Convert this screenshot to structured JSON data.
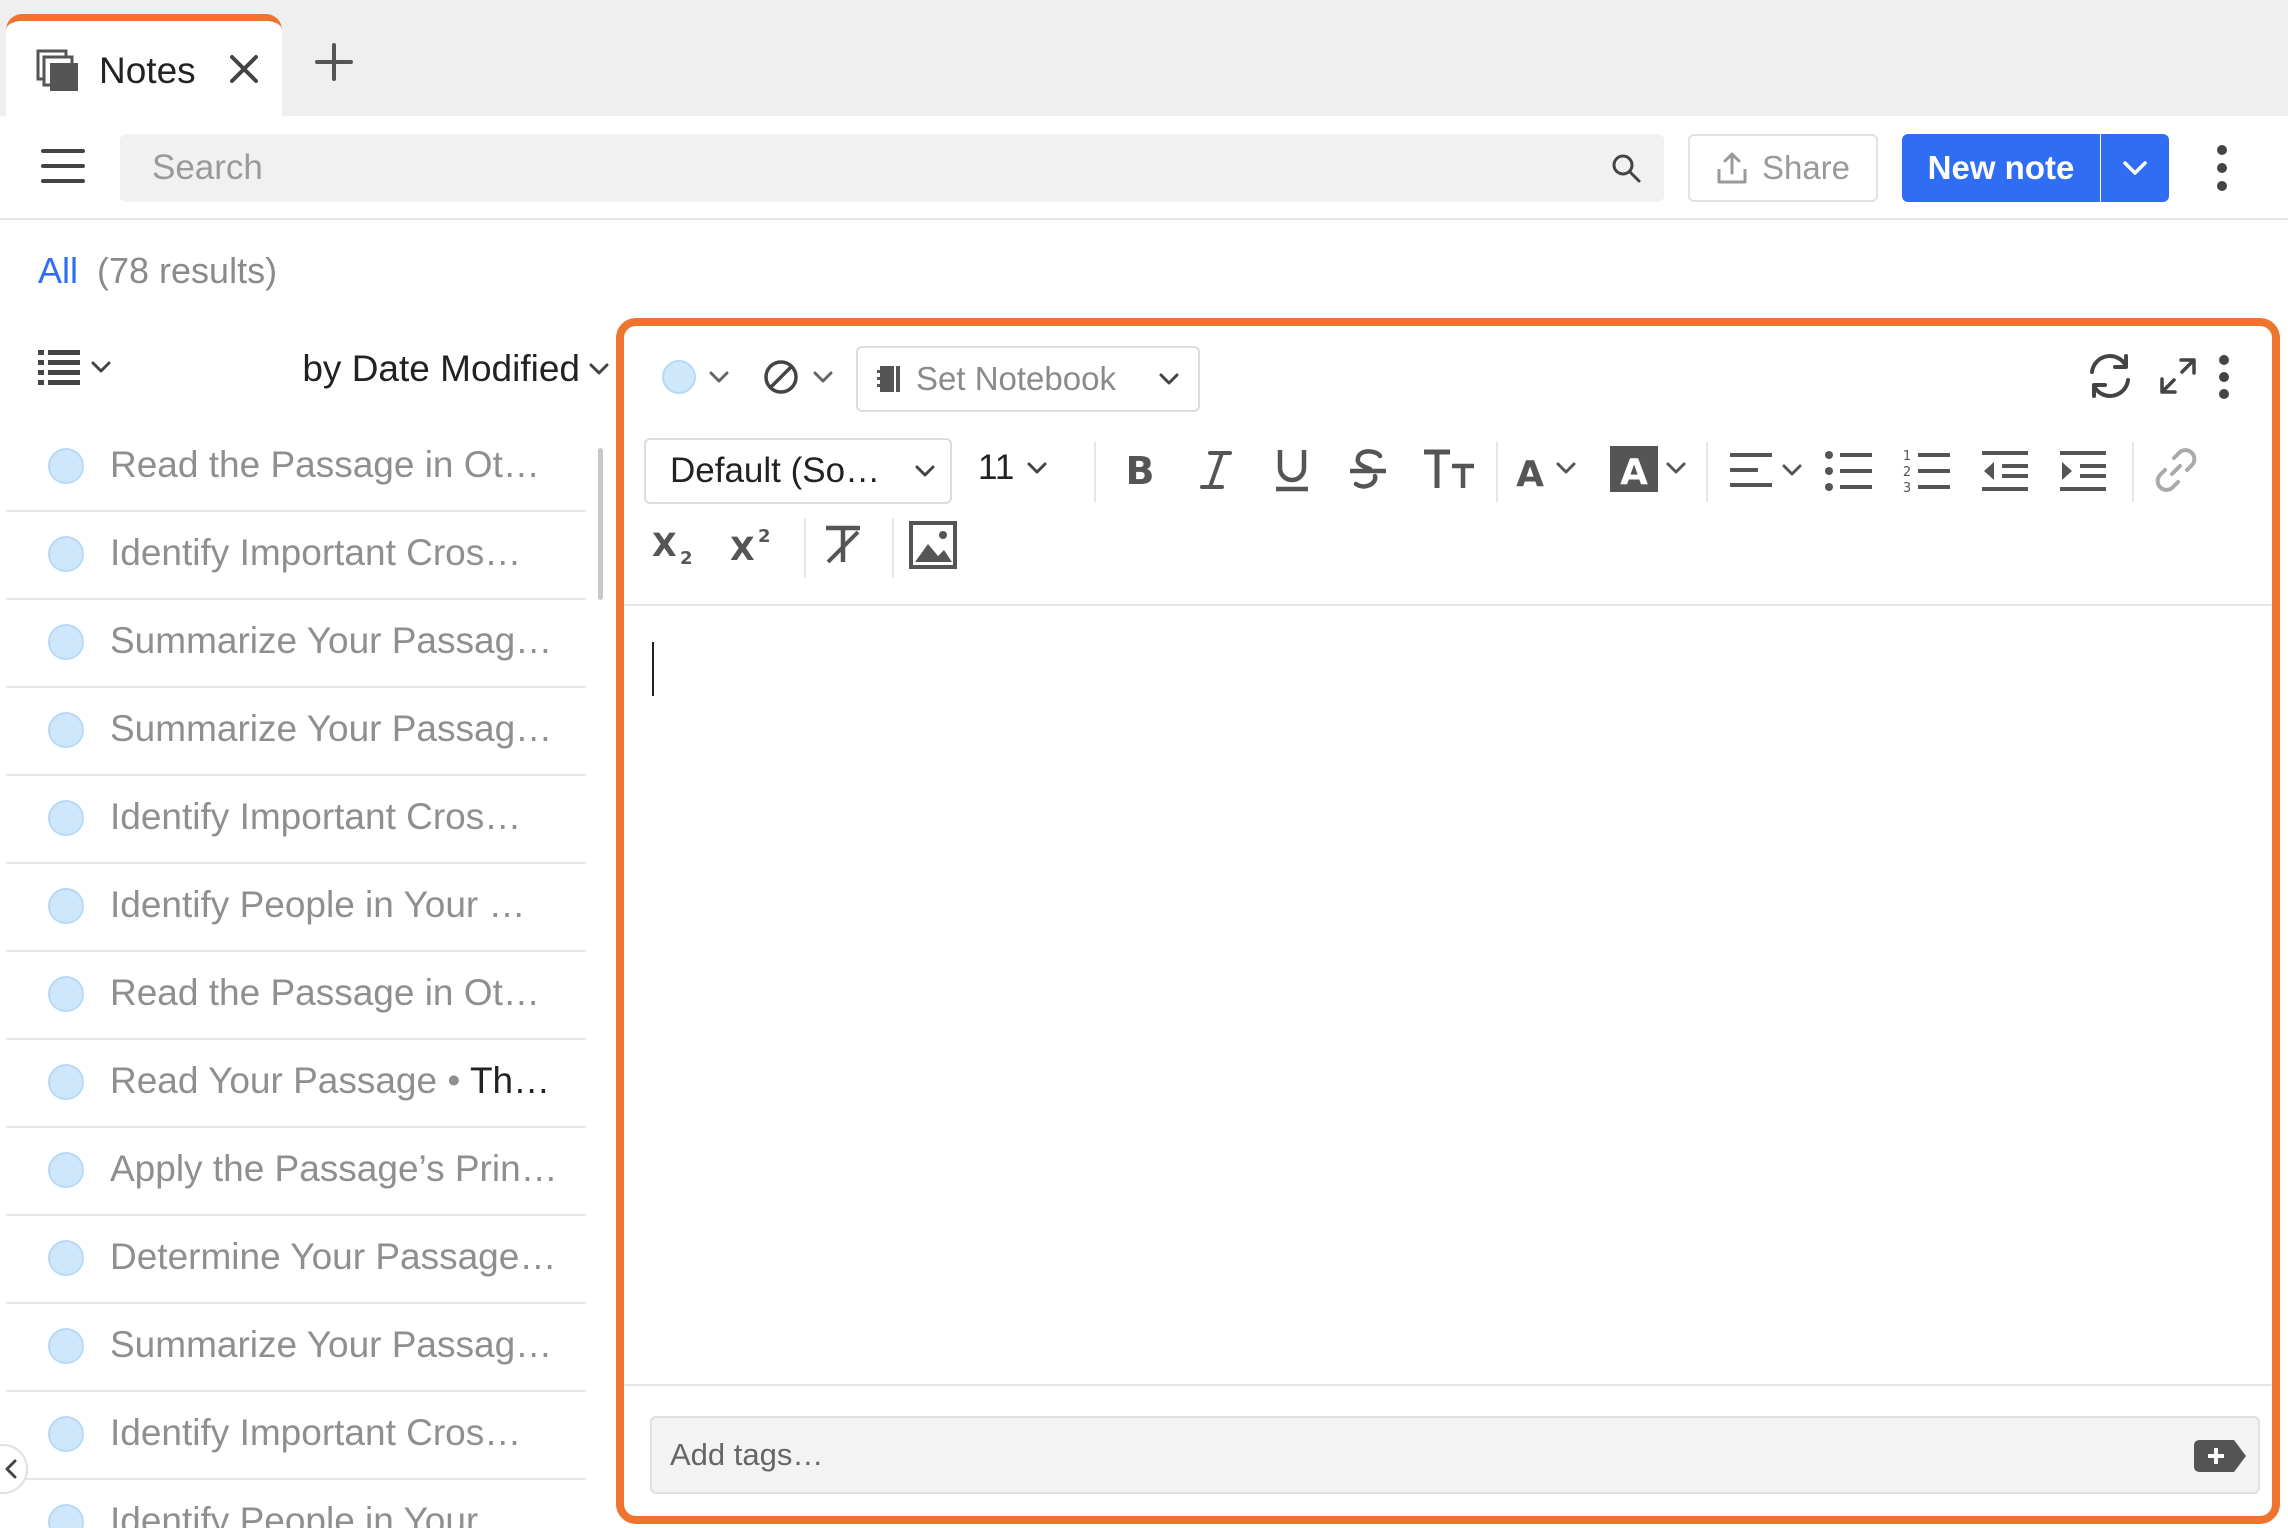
{
  "tab": {
    "title": "Notes"
  },
  "toolbar": {
    "search_placeholder": "Search",
    "share_label": "Share",
    "new_note_label": "New note"
  },
  "filter": {
    "scope": "All",
    "count": "(78 results)"
  },
  "list": {
    "sort_label": "by Date Modified",
    "items": [
      {
        "title": "Read the Passage in Oth…",
        "sub": ""
      },
      {
        "title": "Identify Important Cros…",
        "sub": ""
      },
      {
        "title": "Summarize Your Passag…",
        "sub": ""
      },
      {
        "title": "Summarize Your Passag…",
        "sub": ""
      },
      {
        "title": "Identify Important Cros…",
        "sub": ""
      },
      {
        "title": "Identify People in Your …",
        "sub": ""
      },
      {
        "title": "Read the Passage in Oth…",
        "sub": ""
      },
      {
        "title": "Read Your Passage • ",
        "sub": "Th…"
      },
      {
        "title": "Apply the Passage’s Prin…",
        "sub": ""
      },
      {
        "title": "Determine Your Passage…",
        "sub": ""
      },
      {
        "title": "Summarize Your Passag…",
        "sub": ""
      },
      {
        "title": "Identify Important Cros…",
        "sub": ""
      },
      {
        "title": "Identify People in Your",
        "sub": ""
      }
    ]
  },
  "editor": {
    "notebook_label": "Set Notebook",
    "font_family": "Default (So…",
    "font_size": "11",
    "tags_placeholder": "Add tags…"
  },
  "colors": {
    "accent": "#2f6ef2",
    "highlight_border": "#ee7430",
    "note_dot": "#cfe7fb"
  }
}
